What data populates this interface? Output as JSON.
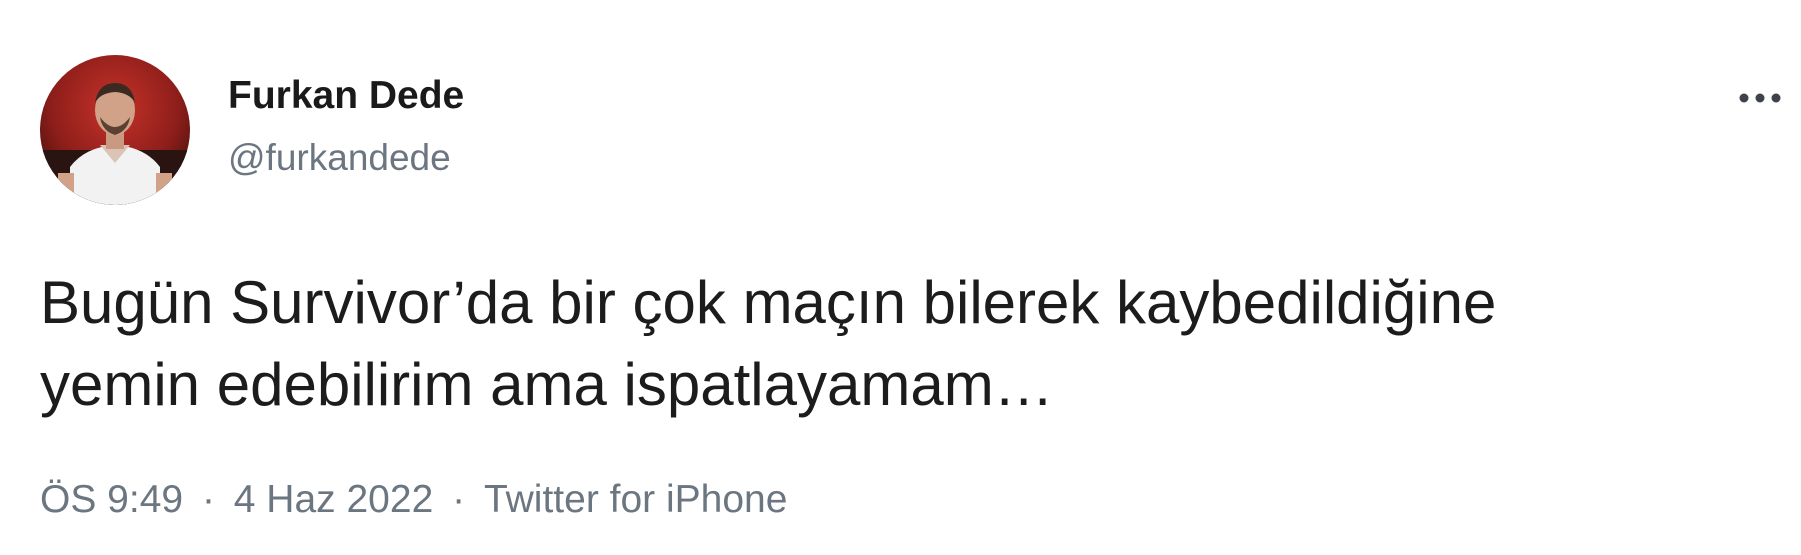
{
  "author": {
    "display_name": "Furkan Dede",
    "handle": "@furkandede",
    "avatar_icon": "profile-photo"
  },
  "more_menu": {
    "icon": "more-horizontal-icon"
  },
  "tweet": {
    "text_lines": [
      "Bugün Survivor’da bir çok maçın bilerek kaybedildiğine",
      "yemin edebilirim ama ispatlayamam…"
    ]
  },
  "meta": {
    "time": "ÖS 9:49",
    "separator": "·",
    "date": "4 Haz 2022",
    "source": "Twitter for iPhone"
  },
  "colors": {
    "text_primary": "#1c1c1c",
    "text_secondary": "#6b7680",
    "background": "#ffffff"
  }
}
